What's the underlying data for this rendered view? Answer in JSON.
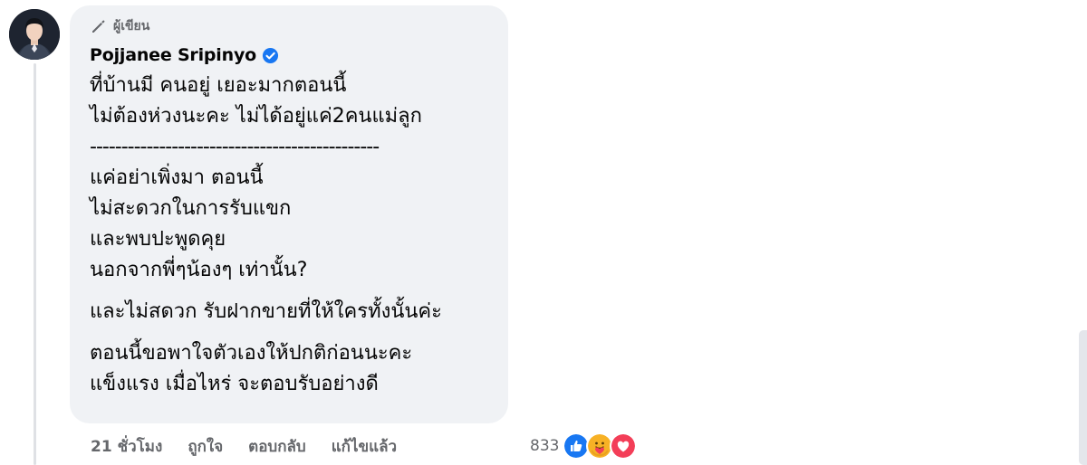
{
  "comment": {
    "author_badge": "ผู้เขียน",
    "author_name": "Pojjanee Sripinyo",
    "paragraph1": [
      "ที่บ้านมี คนอยู่ เยอะมากตอนนี้",
      "ไม่ต้องห่วงนะคะ ไม่ได้อยู่แค่2คนแม่ลูก"
    ],
    "divider": "----------------------------------------------",
    "paragraph2": [
      "แค่อย่าเพิ่งมา ตอนนี้",
      "ไม่สะดวกในการรับแขก",
      "และพบปะพูดคุย",
      "นอกจากพี่ๆน้องๆ เท่านั้น?"
    ],
    "paragraph3": [
      "และไม่สดวก รับฝากขายที่ให้ใครทั้งนั้นค่ะ"
    ],
    "paragraph4": [
      "ตอนนี้ขอพาใจตัวเองให้ปกติก่อนนะคะ",
      "แข็งแรง เมื่อไหร่ จะตอบรับอย่างดี"
    ]
  },
  "actions": {
    "time": "21 ชั่วโมง",
    "like": "ถูกใจ",
    "reply": "ตอบกลับ",
    "edited": "แก้ไขแล้ว"
  },
  "reactions": {
    "count": "833",
    "icons": [
      "like-icon",
      "care-icon",
      "love-icon"
    ]
  },
  "colors": {
    "bubble": "#f0f2f5",
    "text": "#050505",
    "muted": "#65676b",
    "verified": "#1877f2",
    "like": "#1877f2",
    "love": "#f33e58",
    "care": "#f7b125"
  }
}
